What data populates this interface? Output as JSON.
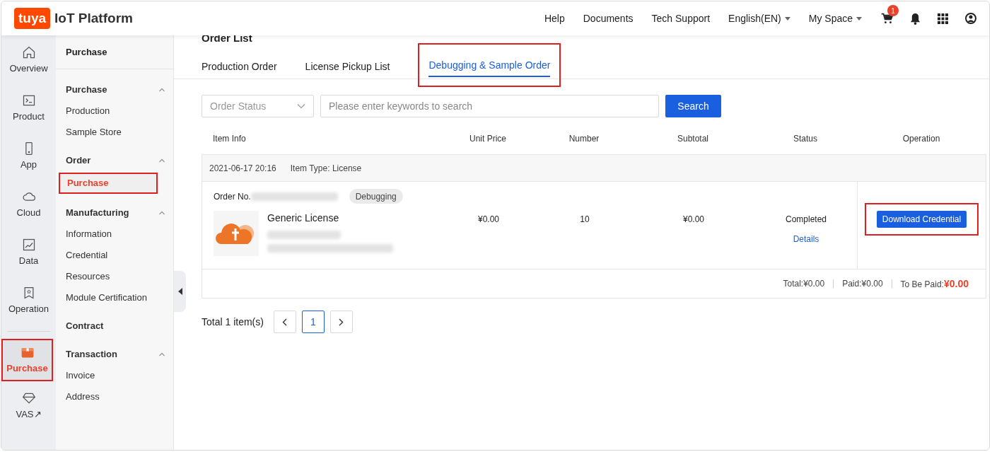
{
  "header": {
    "logo_mark": "tuya",
    "logo_text": "IoT Platform",
    "links": [
      {
        "label": "Help",
        "dropdown": false
      },
      {
        "label": "Documents",
        "dropdown": false
      },
      {
        "label": "Tech Support",
        "dropdown": false
      },
      {
        "label": "English(EN)",
        "dropdown": true
      },
      {
        "label": "My Space",
        "dropdown": true
      }
    ],
    "cart_badge": "1"
  },
  "rail": [
    {
      "label": "Overview",
      "selected": false,
      "highlighted": false
    },
    {
      "label": "Product",
      "selected": false,
      "highlighted": false
    },
    {
      "label": "App",
      "selected": false,
      "highlighted": false
    },
    {
      "label": "Cloud",
      "selected": false,
      "highlighted": false
    },
    {
      "label": "Data",
      "selected": false,
      "highlighted": false
    },
    {
      "label": "Operation",
      "selected": false,
      "highlighted": false
    },
    {
      "label": "Purchase",
      "selected": true,
      "highlighted": true
    },
    {
      "label": "VAS↗",
      "selected": false,
      "highlighted": false
    }
  ],
  "subnav": {
    "title": "Purchase",
    "groups": [
      {
        "label": "Purchase",
        "expanded": true,
        "items": [
          {
            "label": "Production",
            "selected": false,
            "highlighted": false
          },
          {
            "label": "Sample Store",
            "selected": false,
            "highlighted": false
          }
        ]
      },
      {
        "label": "Order",
        "expanded": true,
        "items": [
          {
            "label": "Purchase",
            "selected": true,
            "highlighted": true
          }
        ]
      },
      {
        "label": "Manufacturing",
        "expanded": true,
        "items": [
          {
            "label": "Information",
            "selected": false,
            "highlighted": false
          },
          {
            "label": "Credential",
            "selected": false,
            "highlighted": false
          },
          {
            "label": "Resources",
            "selected": false,
            "highlighted": false
          },
          {
            "label": "Module Certification",
            "selected": false,
            "highlighted": false
          }
        ]
      },
      {
        "label": "Contract"
      },
      {
        "label": "Transaction",
        "expanded": true,
        "items": [
          {
            "label": "Invoice",
            "selected": false,
            "highlighted": false
          },
          {
            "label": "Address",
            "selected": false,
            "highlighted": false
          }
        ]
      }
    ]
  },
  "page_title": "Order List",
  "tabs": [
    {
      "label": "Production Order",
      "selected": false,
      "highlighted": false
    },
    {
      "label": "License Pickup List",
      "selected": false,
      "highlighted": false
    },
    {
      "label": "Debugging & Sample Order",
      "selected": true,
      "highlighted": true
    }
  ],
  "filters": {
    "status_placeholder": "Order Status",
    "search_placeholder": "Please enter keywords to search",
    "search_button": "Search"
  },
  "table": {
    "columns": [
      "Item Info",
      "Unit Price",
      "Number",
      "Subtotal",
      "Status",
      "Operation"
    ],
    "orders": [
      {
        "date": "2021-06-17 20:16",
        "item_type": "Item Type: License",
        "order_no_label": "Order No.",
        "tag": "Debugging",
        "product": "Generic License",
        "unit_price": "¥0.00",
        "number": "10",
        "subtotal": "¥0.00",
        "status": "Completed",
        "details_link": "Details",
        "action": {
          "label": "Download Credential",
          "highlighted": true
        },
        "summary": [
          {
            "label": "Total:",
            "value": "¥0.00",
            "emphasis": false
          },
          {
            "label": "Paid:",
            "value": "¥0.00",
            "emphasis": false
          },
          {
            "label": "To Be Paid:",
            "value": "¥0.00",
            "emphasis": true
          }
        ]
      }
    ]
  },
  "pagination": {
    "total": "Total 1 item(s)",
    "pages": [
      {
        "label": "1",
        "selected": true
      }
    ]
  }
}
